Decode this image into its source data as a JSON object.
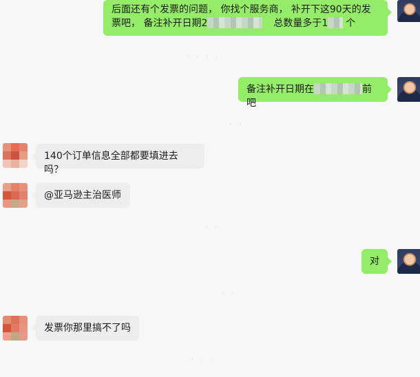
{
  "messages": {
    "m1": {
      "part1": "后面还有个发票的问题， 你找个服务商， 补开下这90天的发票吧， 备注补开日期2",
      "part2": "总数量多于1",
      "part3": "个"
    },
    "m2": {
      "part1": "备注补开日期在",
      "part2": "前吧"
    },
    "m3": {
      "text": "140个订单信息全部都要填进去吗？"
    },
    "m4": {
      "text": "@亚马逊主治医师"
    },
    "m5": {
      "text": "对"
    },
    "m6": {
      "text": "发票你那里搞不了吗"
    }
  },
  "colors": {
    "outgoing_bubble": "#95ec69",
    "incoming_bubble": "#ededed",
    "background": "#f7f7f8"
  }
}
